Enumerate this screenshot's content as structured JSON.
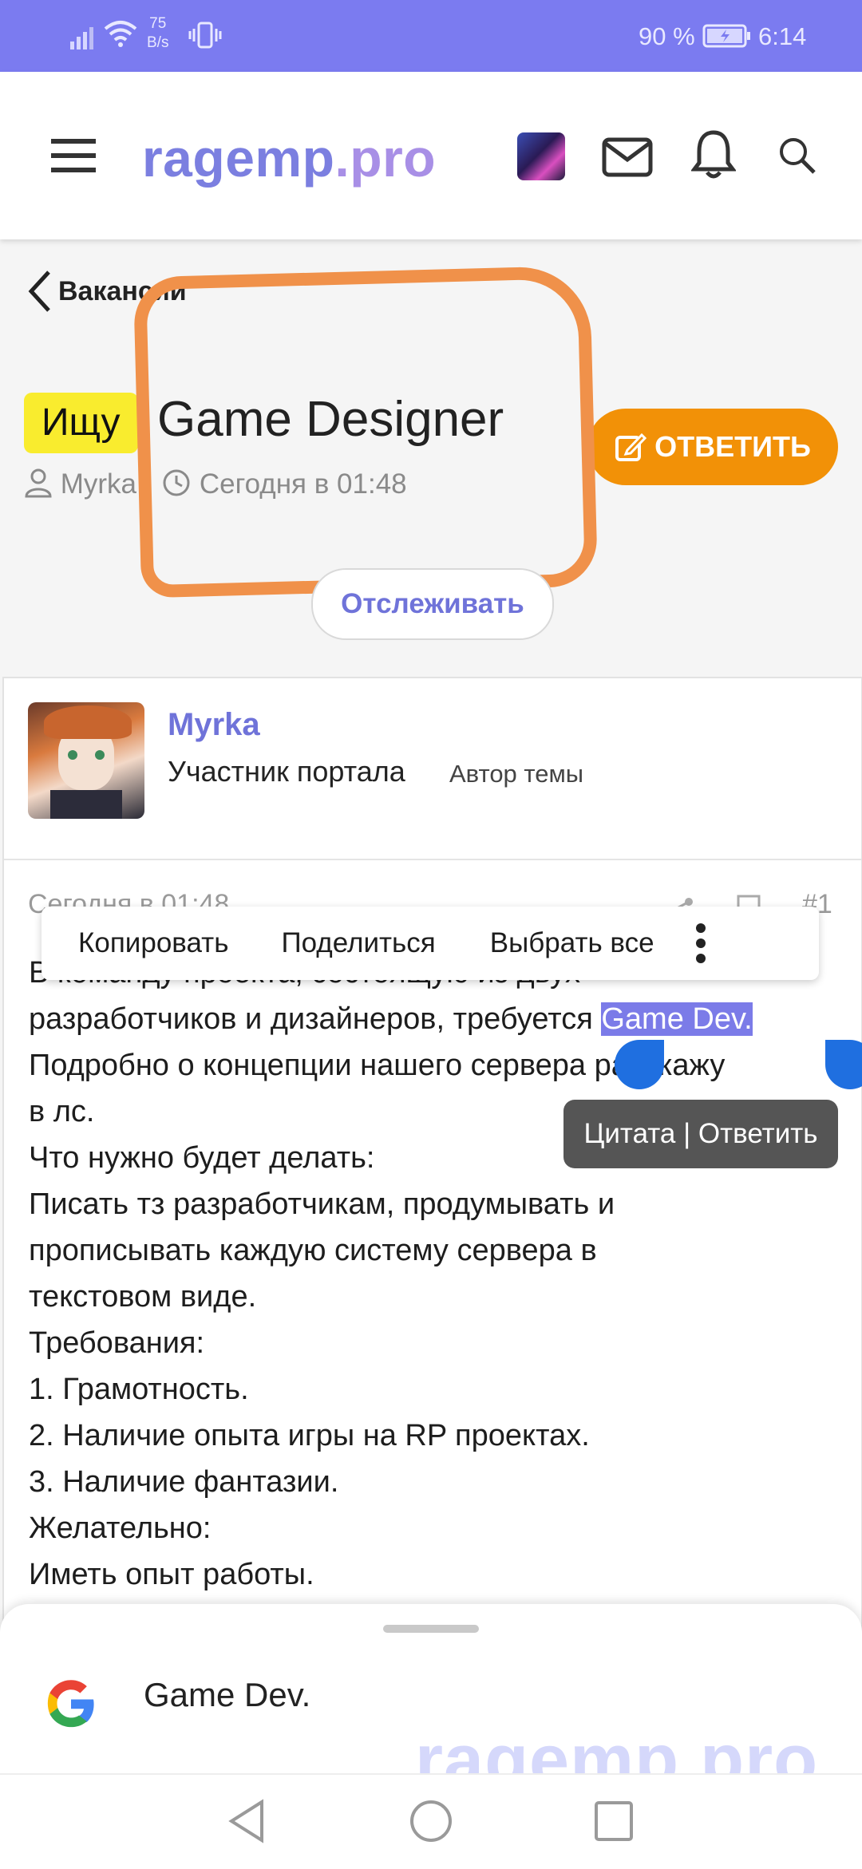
{
  "status_bar": {
    "speed_value": "75",
    "speed_unit": "B/s",
    "battery": "90 %",
    "time": "6:14"
  },
  "header": {
    "logo_main": "ragemp",
    "logo_suffix": ".pro"
  },
  "breadcrumb": "Вакансии",
  "thread": {
    "prefix": "Ищу",
    "title": "Game Designer",
    "author": "Myrka",
    "separator": "·",
    "date": "Сегодня в 01:48",
    "reply_label": "ОТВЕТИТЬ",
    "watch_label": "Отслеживать"
  },
  "post": {
    "username": "Myrka",
    "user_title": "Участник портала",
    "author_tag": "Автор темы",
    "date": "Сегодня в 01:48",
    "number": "#1",
    "lines": [
      "В команду проекта, состоящую из двух",
      "разработчиков и дизайнеров, требуется",
      "Подробно о концепции нашего сервера расскажу",
      "в лс.",
      "Что нужно будет делать:",
      "Писать тз разработчикам, продумывать и",
      "прописывать каждую систему сервера в",
      "текстовом виде.",
      "Требования:",
      "1. Грамотность.",
      "2. Наличие опыта игры на RP проектах.",
      "3. Наличие фантазии.",
      "Желательно:",
      "Иметь опыт работы."
    ],
    "selected_text": "Game Dev."
  },
  "context_menu": {
    "copy": "Копировать",
    "share": "Поделиться",
    "select_all": "Выбрать все"
  },
  "quote_tooltip": "Цитата | Ответить",
  "bottom_sheet": {
    "suggestion": "Game Dev.",
    "watermark": "ragemp.pro"
  },
  "colors": {
    "status_bar": "#7b7bf0",
    "logo_primary": "#7b7fe0",
    "accent_orange": "#f29107",
    "prefix_yellow": "#f9ec2e",
    "selection": "#7b7be8",
    "link": "#6f73d9"
  }
}
